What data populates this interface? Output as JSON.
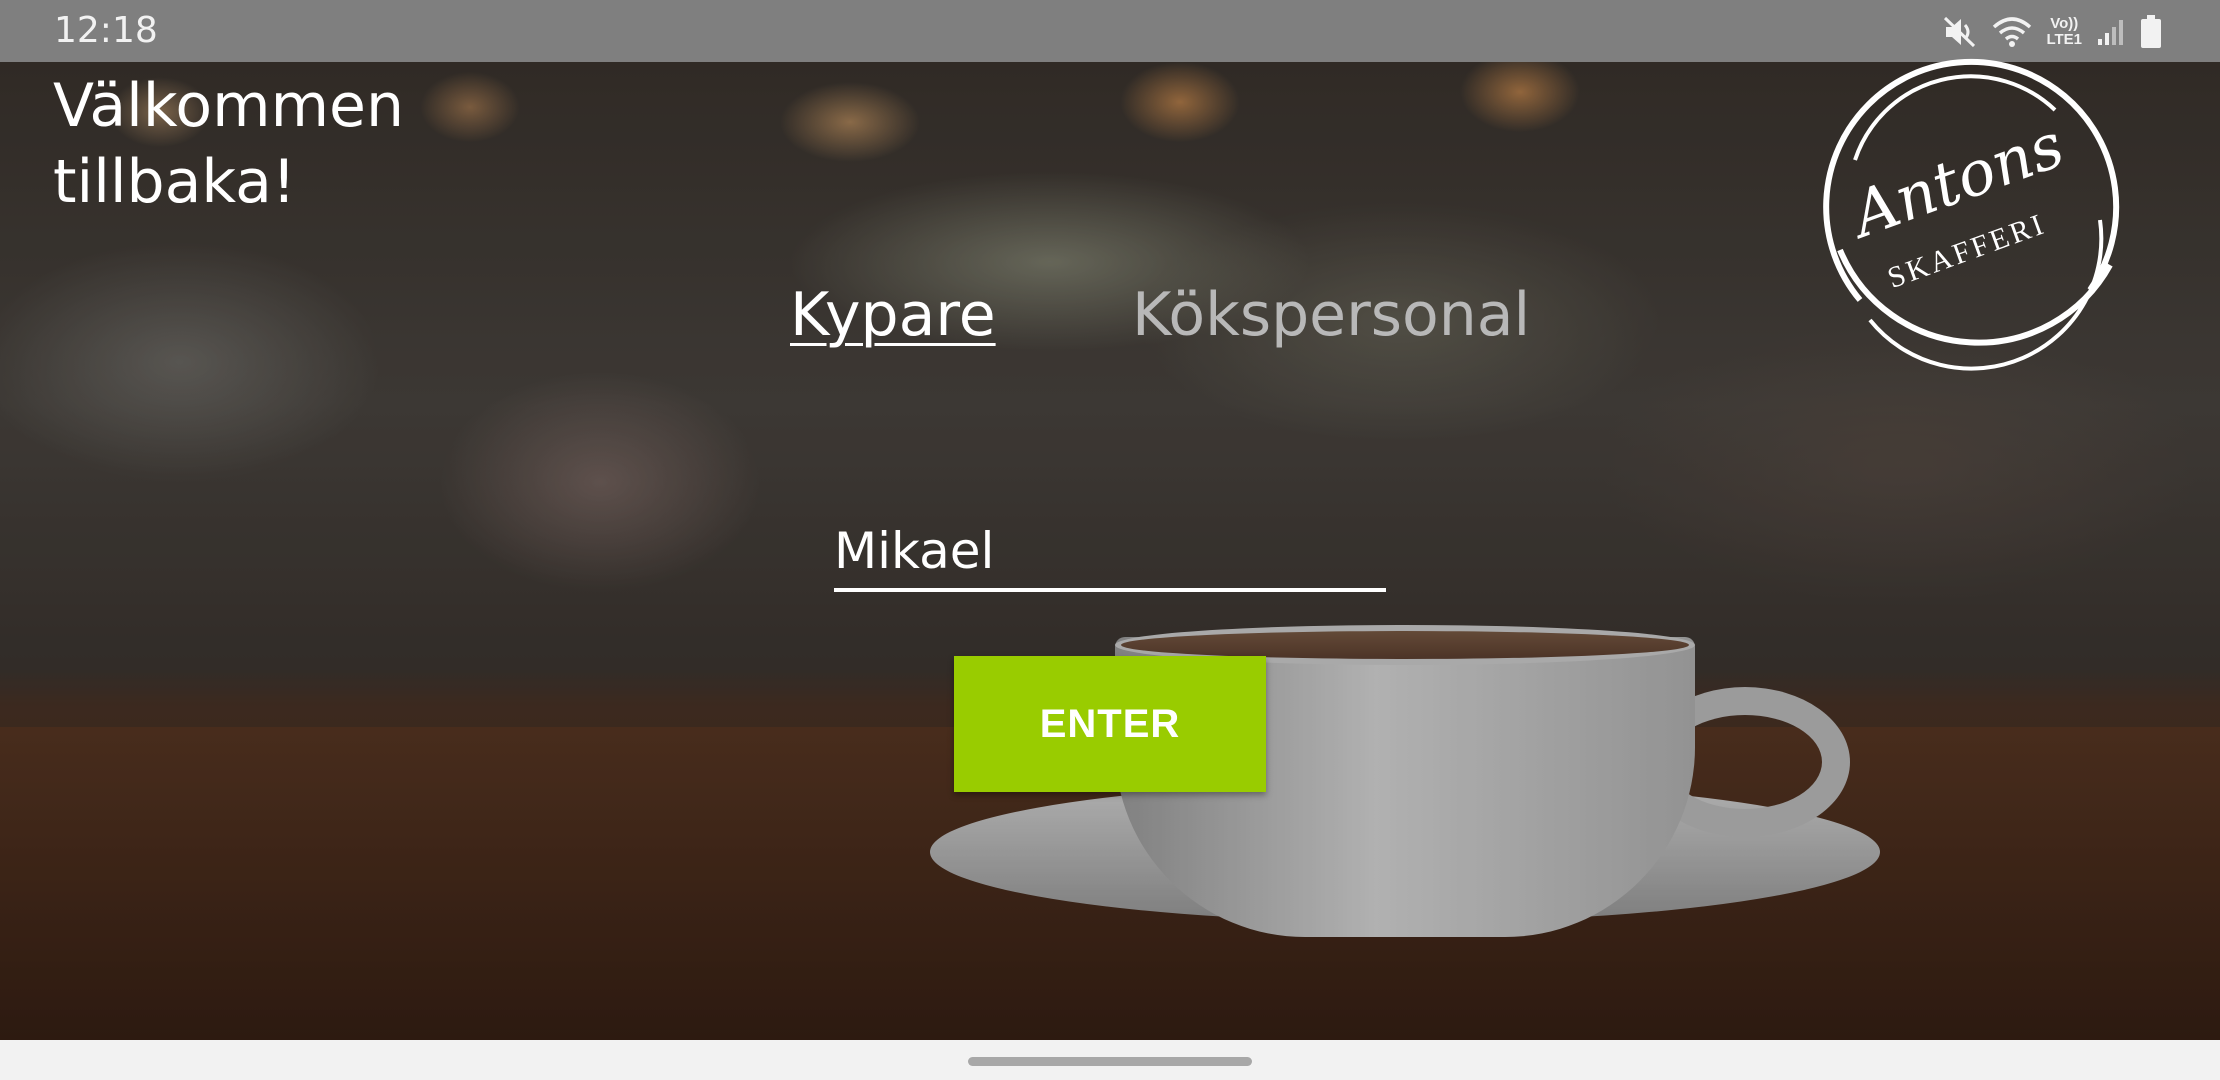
{
  "status_bar": {
    "time": "12:18",
    "icons": [
      "mute-icon",
      "wifi-icon",
      "volte-lte-icon",
      "signal-icon",
      "battery-icon"
    ],
    "volte_label": "Vo))",
    "lte_label": "LTE1"
  },
  "welcome": {
    "line1": "Välkommen",
    "line2": "tillbaka!"
  },
  "logo": {
    "script_text": "Antons",
    "caps_text": "SKAFFERI"
  },
  "tabs": [
    {
      "label": "Kypare",
      "selected": true
    },
    {
      "label": "Kökspersonal",
      "selected": false
    }
  ],
  "name_input": {
    "value": "Mikael"
  },
  "enter_button": {
    "label": "ENTER",
    "color": "#99cc00"
  }
}
